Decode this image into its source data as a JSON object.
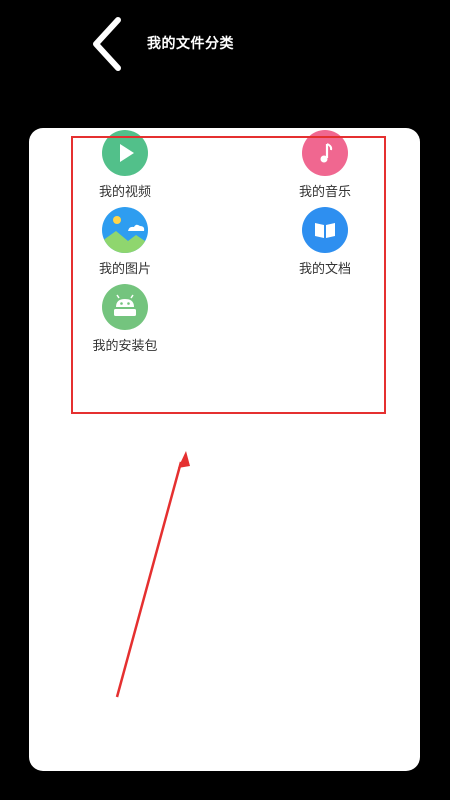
{
  "header": {
    "title": "我的文件分类",
    "back_icon": "chevron-left-icon"
  },
  "categories": [
    {
      "label": "我的视频",
      "icon": "play-icon",
      "color": "#52c08a"
    },
    {
      "label": "我的音乐",
      "icon": "music-note-icon",
      "color": "#f06790"
    },
    {
      "label": "我的图片",
      "icon": "image-icon",
      "color": "#2e9df0"
    },
    {
      "label": "我的文档",
      "icon": "book-icon",
      "color": "#2e8ff0"
    },
    {
      "label": "我的安装包",
      "icon": "android-apk-icon",
      "color": "#74c47e"
    }
  ],
  "annotation": {
    "highlight_color": "#e53030"
  }
}
